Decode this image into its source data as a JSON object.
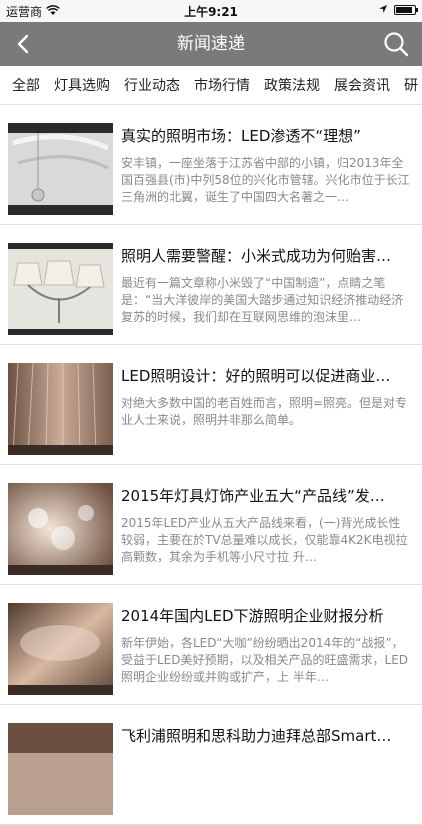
{
  "status_bar": {
    "carrier": "运营商",
    "time": "上午9:21",
    "battery_level": 0.9
  },
  "nav": {
    "title": "新闻速递",
    "back_icon": "chevron-left-icon",
    "search_icon": "search-icon"
  },
  "tabs": [
    {
      "label": "全部"
    },
    {
      "label": "灯具选购"
    },
    {
      "label": "行业动态"
    },
    {
      "label": "市场行情"
    },
    {
      "label": "政策法规"
    },
    {
      "label": "展会资讯"
    },
    {
      "label": "研"
    }
  ],
  "articles": [
    {
      "title": "真实的照明市场：LED渗透不“理想”",
      "desc": "安丰镇，一座坐落于江苏省中部的小镇，归2013年全国百强县(市)中列58位的兴化市管辖。兴化市位于长江三角洲的北翼，诞生了中国四大名著之一…"
    },
    {
      "title": "照明人需要警醒：小米式成功为何贻害…",
      "desc": "最近有一篇文章称小米毁了“中国制造”，点睛之笔是：“当大洋彼岸的美国大踏步通过知识经济推动经济复苏的时候，我们却在互联网思维的泡沫里…"
    },
    {
      "title": "LED照明设计：好的照明可以促进商业…",
      "desc": "    对绝大多数中国的老百姓而言，照明=照亮。但是对专业人士来说，照明并非那么简单。"
    },
    {
      "title": "2015年灯具灯饰产业五大“产品线”发…",
      "desc": "    2015年LED产业从五大产品线来看，(一)背光成长性较弱，主要在於TV总量难以成长，仅能靠4K2K电视拉高颗数，其余为手机等小尺寸拉 升…"
    },
    {
      "title": "2014年国内LED下游照明企业财报分析",
      "desc": "新年伊始，各LED“大咖”纷纷晒出2014年的“战报”，受益于LED美好预期，以及相关产品的旺盛需求，LED照明企业纷纷或并购或扩产，上 半年…"
    },
    {
      "title": "飞利浦照明和思科助力迪拜总部Smart…",
      "desc": ""
    }
  ]
}
